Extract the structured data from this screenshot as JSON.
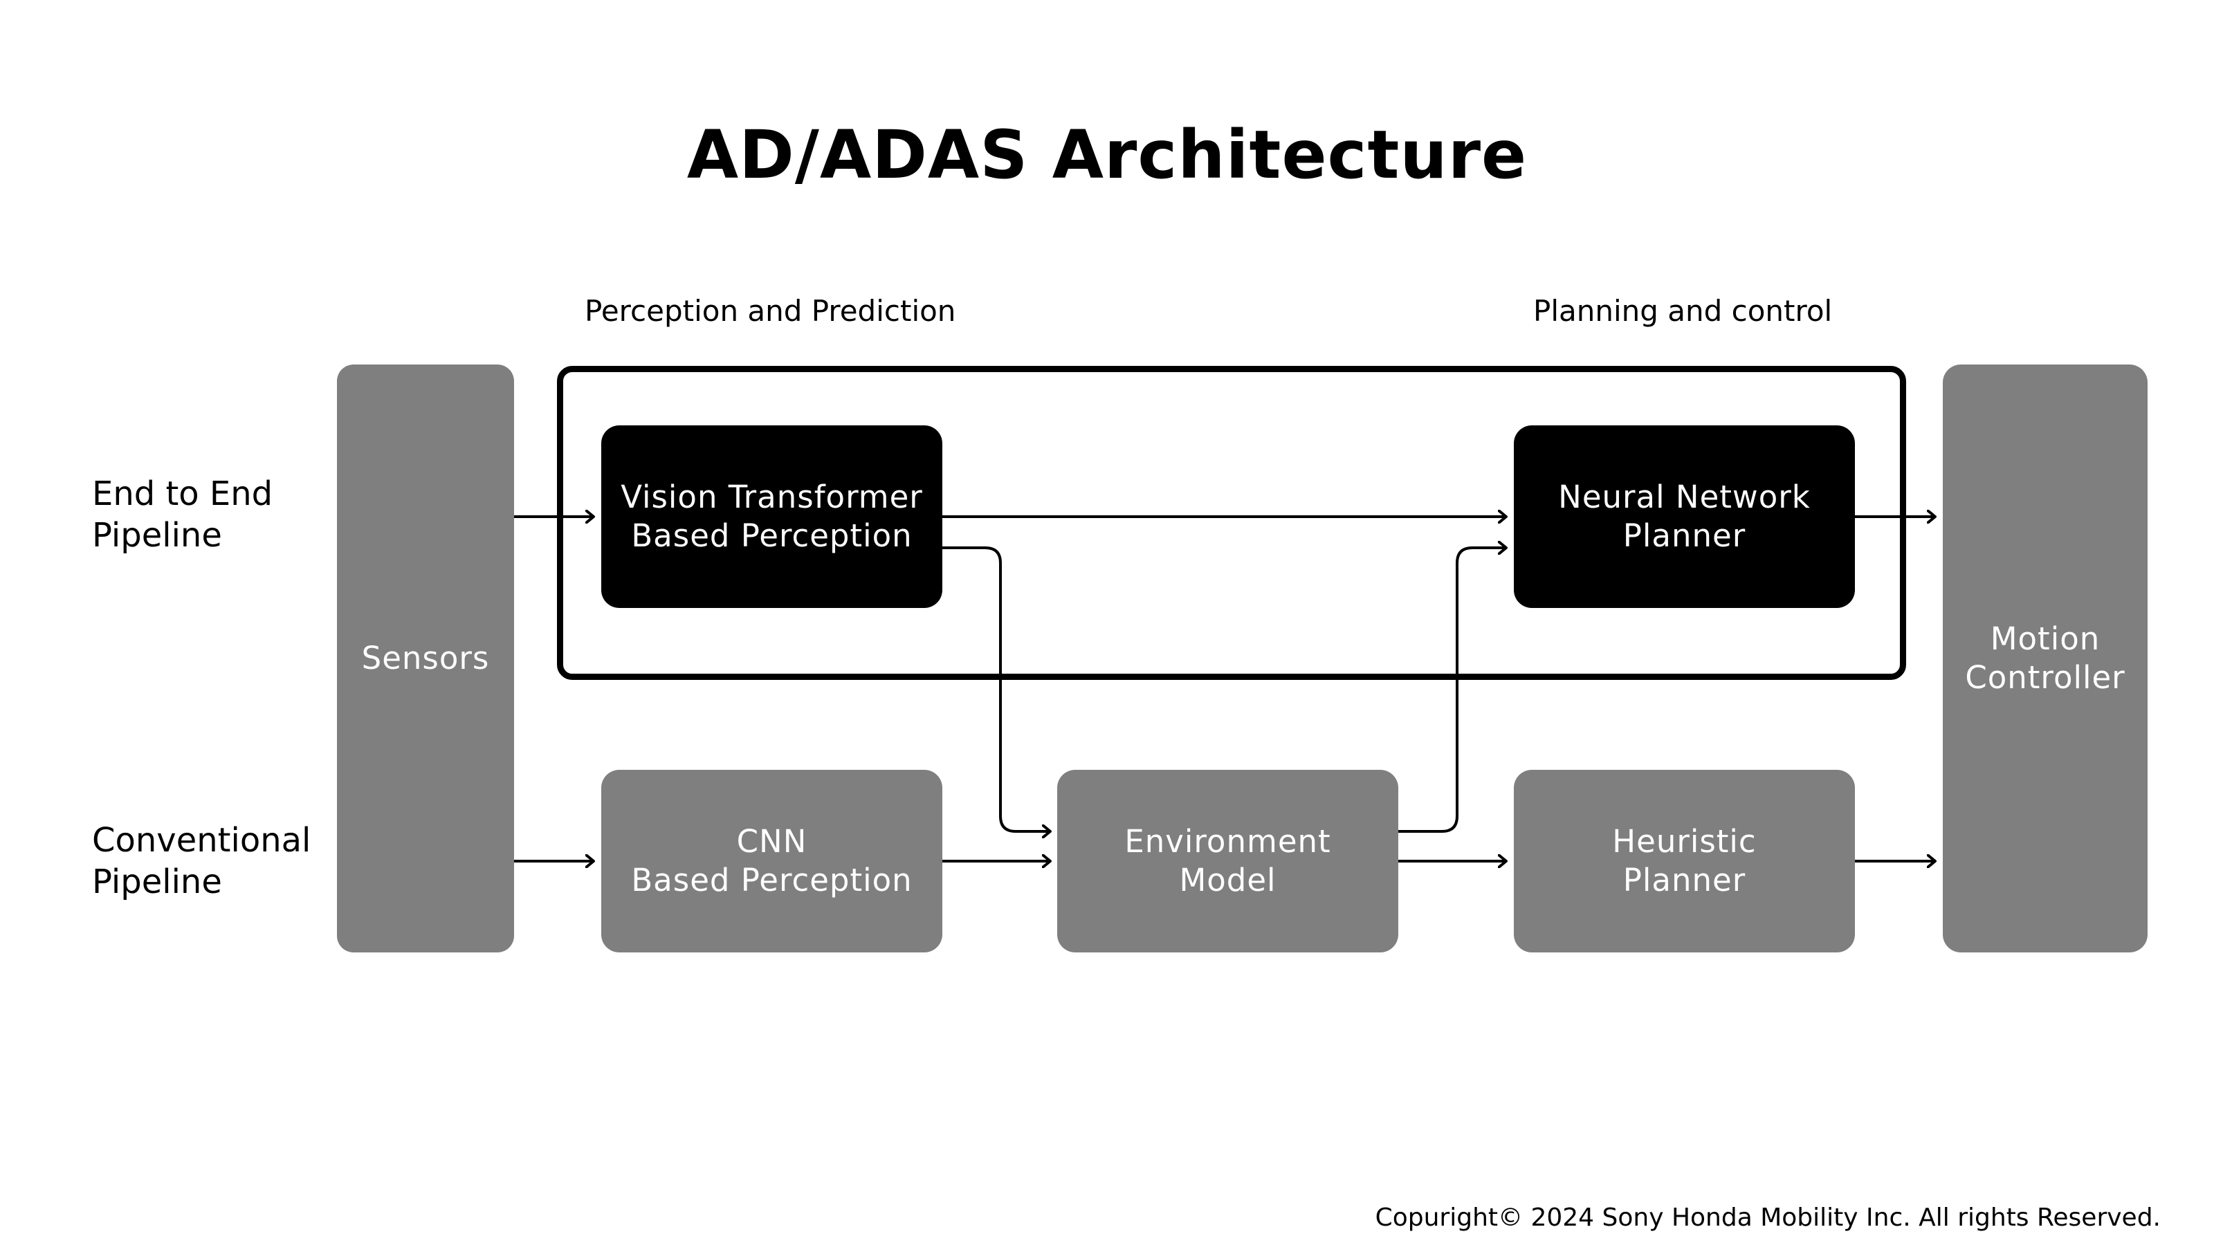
{
  "title": "AD/ADAS Architecture",
  "section_labels": {
    "perception": "Perception and Prediction",
    "planning": "Planning and control"
  },
  "row_labels": {
    "end_to_end": "End to End\nPipeline",
    "conventional": "Conventional\nPipeline"
  },
  "nodes": {
    "sensors": "Sensors",
    "vit_perception": "Vision Transformer\nBased Perception",
    "nn_planner": "Neural Network\nPlanner",
    "motion_controller": "Motion\nController",
    "cnn_perception": "CNN\nBased Perception",
    "environment_model": "Environment\nModel",
    "heuristic_planner": "Heuristic\nPlanner"
  },
  "edges": [
    {
      "from": "sensors",
      "to": "vit_perception"
    },
    {
      "from": "vit_perception",
      "to": "nn_planner"
    },
    {
      "from": "vit_perception",
      "to": "environment_model"
    },
    {
      "from": "environment_model",
      "to": "nn_planner"
    },
    {
      "from": "nn_planner",
      "to": "motion_controller"
    },
    {
      "from": "sensors",
      "to": "cnn_perception"
    },
    {
      "from": "cnn_perception",
      "to": "environment_model"
    },
    {
      "from": "environment_model",
      "to": "heuristic_planner"
    },
    {
      "from": "heuristic_planner",
      "to": "motion_controller"
    }
  ],
  "colors": {
    "module_gray": "#7f7f7f",
    "module_black": "#000000",
    "text_light": "#ffffff"
  },
  "copyright": "Copuright© 2024 Sony Honda Mobility Inc. All rights Reserved."
}
